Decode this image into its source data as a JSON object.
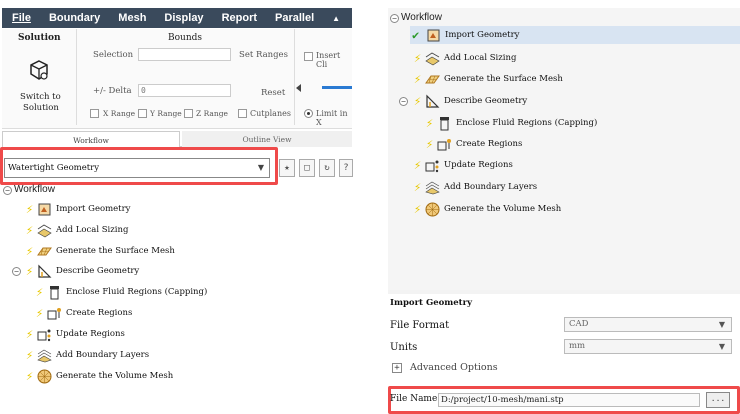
{
  "menu": {
    "items": [
      "File",
      "Boundary",
      "Mesh",
      "Display",
      "Report",
      "Parallel"
    ],
    "more": "▲"
  },
  "ribbon": {
    "solution_title": "Solution",
    "switch_label_1": "Switch to",
    "switch_label_2": "Solution",
    "bounds_title": "Bounds",
    "selection_label": "Selection",
    "set_ranges_label": "Set Ranges",
    "delta_label": "+/- Delta",
    "delta_value": "0",
    "reset_label": "Reset",
    "x_range": "X Range",
    "y_range": "Y Range",
    "z_range": "Z Range",
    "cutplanes": "Cutplanes",
    "insert_clip": "Insert Cli",
    "limit_in": "Limit in X"
  },
  "tabs": {
    "workflow": "Workflow",
    "outline": "Outline View"
  },
  "workflow_type": {
    "value": "Watertight Geometry"
  },
  "tree": {
    "root": "Workflow",
    "items": [
      "Import Geometry",
      "Add Local Sizing",
      "Generate the Surface Mesh",
      "Describe Geometry",
      "Enclose Fluid Regions (Capping)",
      "Create Regions",
      "Update Regions",
      "Add Boundary Layers",
      "Generate the Volume Mesh"
    ]
  },
  "props": {
    "title": "Import Geometry",
    "file_format_label": "File Format",
    "file_format_value": "CAD",
    "units_label": "Units",
    "units_value": "mm",
    "advanced": "Advanced Options",
    "file_name_label": "File Name",
    "file_name_value": "D:/project/10-mesh/mani.stp",
    "browse": "..."
  },
  "colors": {
    "highlight": "#ef4a4a",
    "menubar": "#3a4a5c",
    "bolt": "#e8c800",
    "check": "#2a9a2a"
  }
}
